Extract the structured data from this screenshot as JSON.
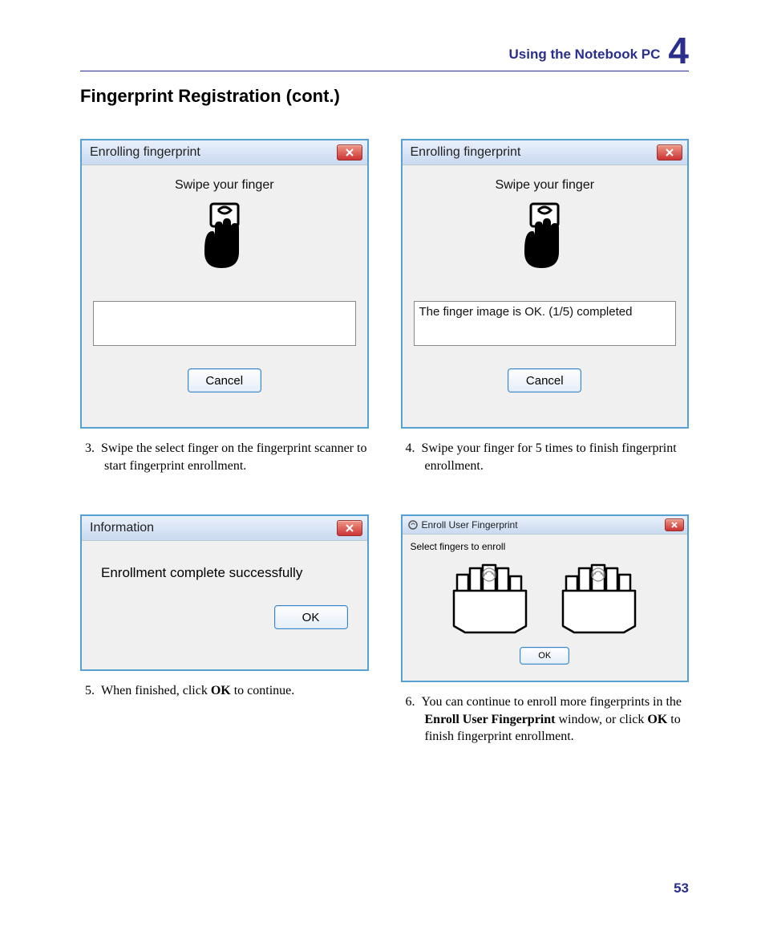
{
  "header": {
    "chapter_label": "Using the Notebook PC",
    "chapter_num": "4"
  },
  "section_title": "Fingerprint Registration (cont.)",
  "shots": {
    "s3": {
      "title": "Enrolling fingerprint",
      "swipe_text": "Swipe your finger",
      "status": "",
      "button": "Cancel"
    },
    "s4": {
      "title": "Enrolling fingerprint",
      "swipe_text": "Swipe your finger",
      "status": "The finger image is OK. (1/5) completed",
      "button": "Cancel"
    },
    "s5": {
      "title": "Information",
      "message": "Enrollment complete successfully",
      "button": "OK"
    },
    "s6": {
      "title": "Enroll User Fingerprint",
      "label": "Select fingers to enroll",
      "button": "OK"
    }
  },
  "captions": {
    "c3_num": "3.",
    "c3_a": "Swipe the select finger on the fingerprint scanner to start fingerprint enrollment.",
    "c4_num": "4.",
    "c4_a": "Swipe your finger for 5 times to finish fingerprint enrollment.",
    "c5_num": "5.",
    "c5_a": "When finished, click ",
    "c5_b": "OK",
    "c5_c": " to continue.",
    "c6_num": "6.",
    "c6_a": "You can continue to enroll more finger­prints in the ",
    "c6_b": "Enroll User Fingerprint",
    "c6_c": " window, or click ",
    "c6_d": "OK",
    "c6_e": " to finish fingerprint enrollment."
  },
  "page_number": "53"
}
